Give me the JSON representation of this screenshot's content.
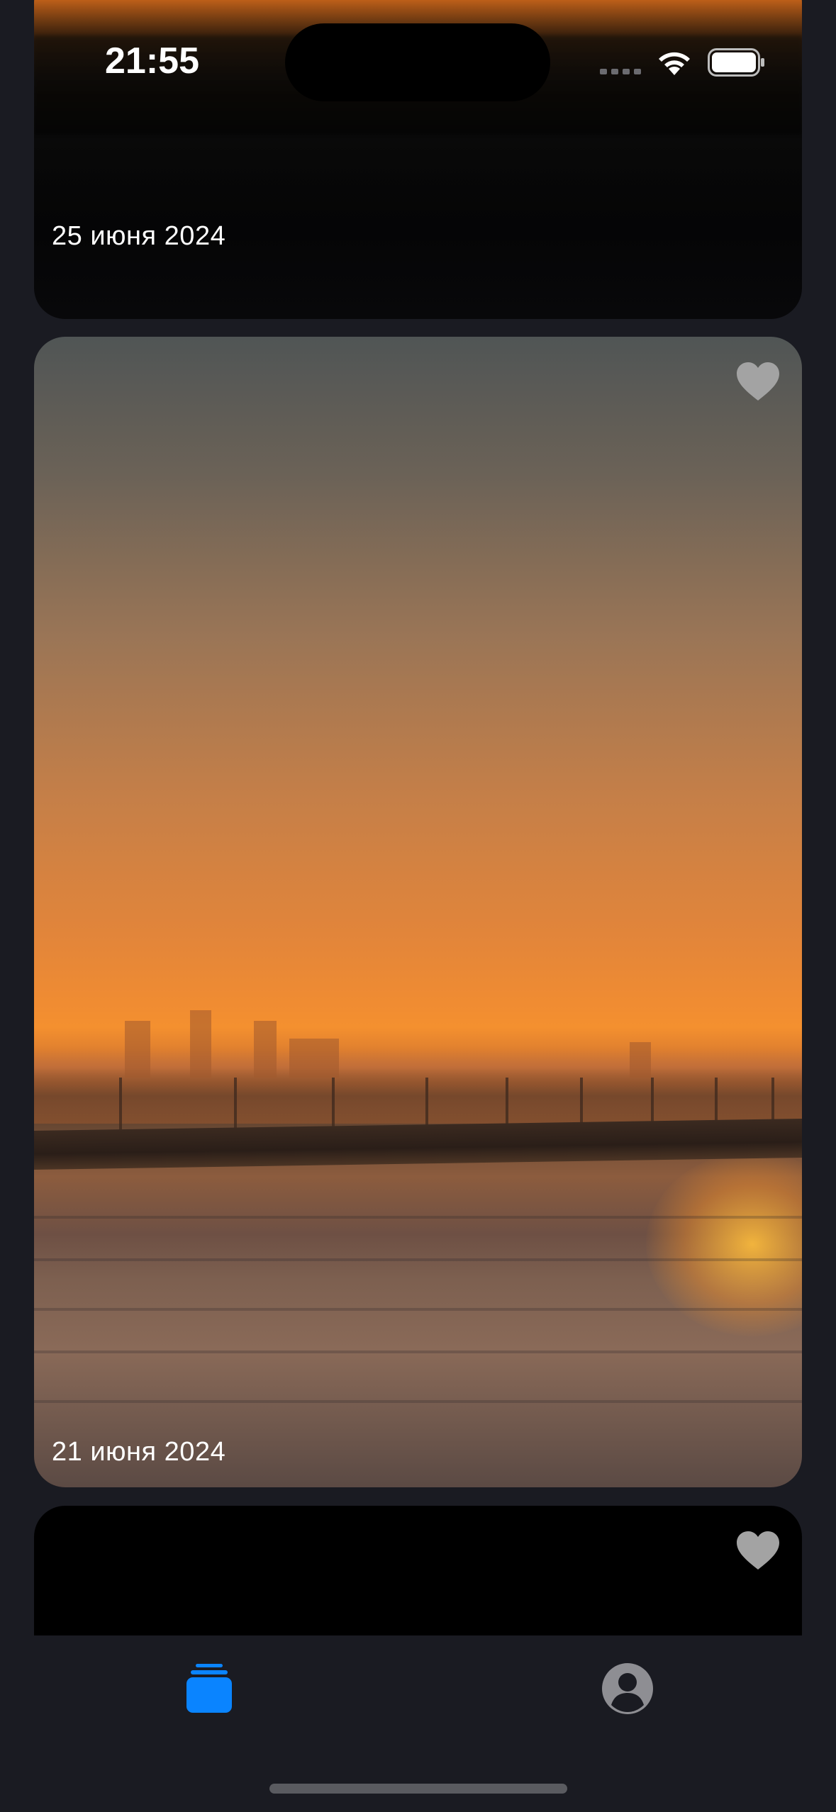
{
  "status_bar": {
    "time": "21:55",
    "icons": [
      "cellular-signal-icon",
      "wifi-icon",
      "battery-icon"
    ]
  },
  "feed": {
    "items": [
      {
        "date": "25 июня 2024",
        "liked": false
      },
      {
        "date": "21 июня 2024",
        "liked": false
      },
      {
        "date": "",
        "liked": false
      }
    ]
  },
  "tab_bar": {
    "tabs": [
      {
        "icon": "stack-icon",
        "selected": true
      },
      {
        "icon": "person-circle-icon",
        "selected": false
      }
    ]
  },
  "colors": {
    "background": "#1a1b22",
    "accent": "#0a84ff",
    "heart": "#a3a3a3",
    "inactive_tab": "#8e8e93"
  }
}
